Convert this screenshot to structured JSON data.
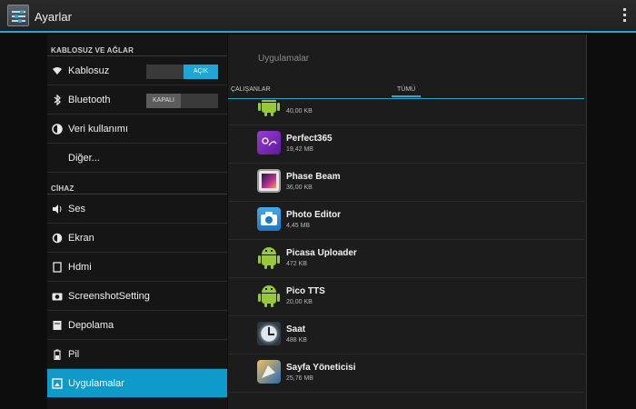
{
  "header": {
    "title": "Ayarlar"
  },
  "sidebar": {
    "sections": [
      {
        "label": "KABLOSUZ VE AĞLAR"
      },
      {
        "label": "CİHAZ"
      }
    ],
    "items": [
      {
        "label": "Kablosuz",
        "icon": "wifi-icon",
        "toggle": "AÇIK"
      },
      {
        "label": "Bluetooth",
        "icon": "bluetooth-icon",
        "toggle": "KAPALI"
      },
      {
        "label": "Veri kullanımı",
        "icon": "data-usage-icon"
      },
      {
        "label": "Diğer..."
      },
      {
        "label": "Ses",
        "icon": "volume-icon"
      },
      {
        "label": "Ekran",
        "icon": "brightness-icon"
      },
      {
        "label": "Hdmi",
        "icon": "hdmi-icon"
      },
      {
        "label": "ScreenshotSetting",
        "icon": "camera-icon"
      },
      {
        "label": "Depolama",
        "icon": "storage-icon"
      },
      {
        "label": "Pil",
        "icon": "battery-icon"
      },
      {
        "label": "Uygulamalar",
        "icon": "apps-icon",
        "active": true
      }
    ]
  },
  "main": {
    "title": "Uygulamalar",
    "tabs": [
      {
        "label": "ÇALIŞANLAR"
      },
      {
        "label": "TÜMÜ",
        "selected": true
      }
    ],
    "apps": [
      {
        "name": "",
        "size": "40,00 KB",
        "icon": "android-icon"
      },
      {
        "name": "Perfect365",
        "size": "19,42 MB",
        "icon": "perfect365-icon"
      },
      {
        "name": "Phase Beam",
        "size": "36,00 KB",
        "icon": "phase-beam-icon"
      },
      {
        "name": "Photo Editor",
        "size": "4,45 MB",
        "icon": "photo-editor-icon"
      },
      {
        "name": "Picasa Uploader",
        "size": "472 KB",
        "icon": "android-icon"
      },
      {
        "name": "Pico TTS",
        "size": "20,00 KB",
        "icon": "android-icon"
      },
      {
        "name": "Saat",
        "size": "488 KB",
        "icon": "clock-icon"
      },
      {
        "name": "Sayfa Yöneticisi",
        "size": "25,76 MB",
        "icon": "file-manager-icon"
      }
    ]
  },
  "colors": {
    "accent": "#2aa6d0",
    "active_bg": "#0f9bc9",
    "android_green": "#98c93c"
  }
}
